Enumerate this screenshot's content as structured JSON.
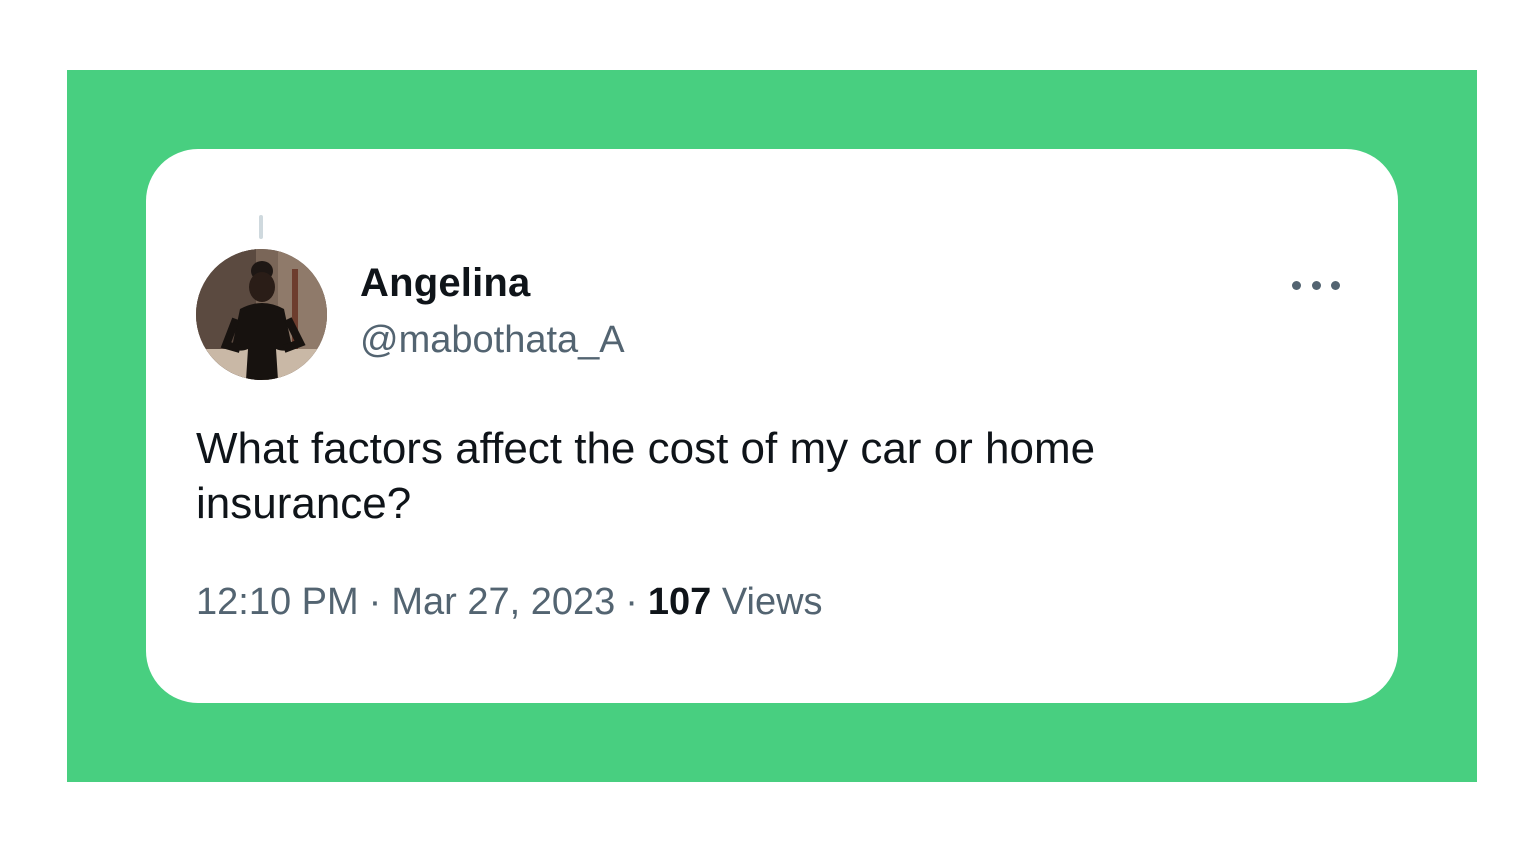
{
  "colors": {
    "frame_background": "#48cf80",
    "card_background": "#ffffff",
    "primary_text": "#0f1419",
    "secondary_text": "#536471"
  },
  "tweet": {
    "author": {
      "display_name": "Angelina",
      "handle": "@mabothata_A",
      "avatar_icon": "profile-photo"
    },
    "more_icon": "more-horizontal-icon",
    "text": "What factors affect the cost of my car or home insurance?",
    "time": "12:10 PM",
    "date": "Mar 27, 2023",
    "separator": "·",
    "views_count": "107",
    "views_label": "Views"
  }
}
